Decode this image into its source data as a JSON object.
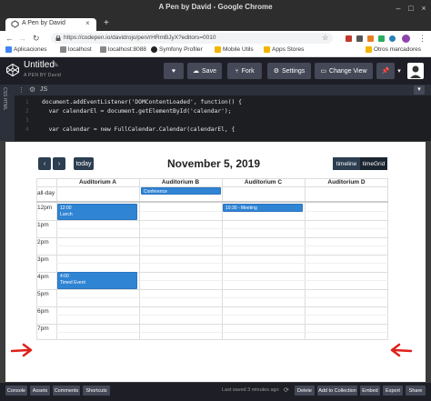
{
  "window": {
    "title": "A Pen by David - Google Chrome"
  },
  "tab": {
    "label": "A Pen by David",
    "close": "×",
    "new": "+"
  },
  "address": {
    "url": "https://codepen.io/davidrojo/pen/rHRmBJyX?editors=0010"
  },
  "bookmarks": [
    {
      "label": "Aplicaciones",
      "color": "#4285f4"
    },
    {
      "label": "localhost",
      "color": "#888888"
    },
    {
      "label": "localhost:8088",
      "color": "#888888"
    },
    {
      "label": "Symfony Profiler",
      "color": "#222222"
    },
    {
      "label": "Mobile Utils",
      "color": "#f4b400"
    },
    {
      "label": "Apps Stores",
      "color": "#f4b400"
    },
    {
      "label": "Otros marcadores",
      "color": "#f4b400"
    }
  ],
  "codepen": {
    "title": "Untitled",
    "author": "A PEN BY David",
    "buttons": {
      "save": "Save",
      "fork": "Fork",
      "settings": "Settings",
      "change_view": "Change View"
    }
  },
  "editor": {
    "side_label": "CSS HTML",
    "pane_label": "JS",
    "line_numbers": [
      "1",
      "2",
      "3",
      "4"
    ],
    "lines": [
      "document.addEventListener('DOMContentLoaded', function() {",
      "  var calendarEl = document.getElementById('calendar');",
      "",
      "  var calendar = new FullCalendar.Calendar(calendarEl, {"
    ]
  },
  "calendar": {
    "title": "November 5, 2019",
    "prev": "‹",
    "next": "›",
    "today": "today",
    "views": [
      "timeline",
      "timeGrid"
    ],
    "resources": [
      "Auditorium A",
      "Auditorium B",
      "Auditorium C",
      "Auditorium D"
    ],
    "allday_label": "all-day",
    "times": [
      "12pm",
      "1pm",
      "2pm",
      "3pm",
      "4pm",
      "5pm",
      "6pm",
      "7pm"
    ],
    "events": [
      {
        "time": "",
        "title": "Conference"
      },
      {
        "time": "12:00",
        "title": "Lunch"
      },
      {
        "time": "10:30 - Meeting",
        "title": ""
      },
      {
        "time": "4:00",
        "title": "Timed Event"
      }
    ]
  },
  "bottom": {
    "left": [
      "Console",
      "Assets",
      "Comments",
      "Shortcuts"
    ],
    "saved": "Last saved 3 minutes ago",
    "right": [
      "Delete",
      "Add to Collection",
      "Embed",
      "Export",
      "Share"
    ]
  },
  "colors": {
    "accent": "#2f84d3",
    "arrow": "#e0201b",
    "button_dark": "#2c3e50"
  }
}
